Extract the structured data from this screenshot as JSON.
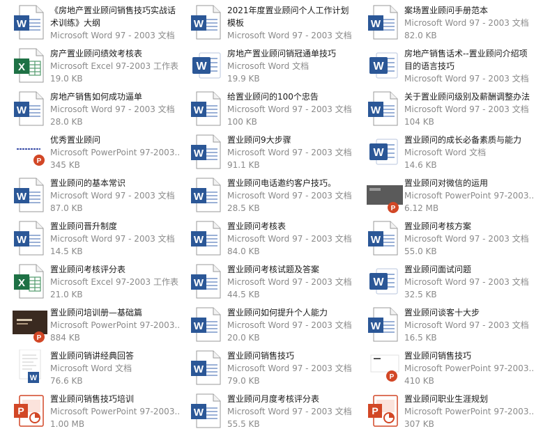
{
  "colors": {
    "word": "#2b5797",
    "excel": "#1e7145",
    "ppt": "#d24726",
    "name": "#1a1a1a",
    "meta": "#8a8a8a"
  },
  "files": [
    {
      "name": "《房地产置业顾问销售技巧实战话术训练》大纲",
      "type": "Microsoft Word 97 - 2003 文档",
      "size": "",
      "icon": "word-doc-icon",
      "kind": "word"
    },
    {
      "name": "2021年度置业顾问个人工作计划模板",
      "type": "Microsoft Word 97 - 2003 文档",
      "size": "",
      "icon": "word-doc-icon",
      "kind": "word"
    },
    {
      "name": "案场置业顾问手册范本",
      "type": "Microsoft Word 97 - 2003 文档",
      "size": "82.0 KB",
      "icon": "word-doc-icon",
      "kind": "word"
    },
    {
      "name": "房产置业顾问绩效考核表",
      "type": "Microsoft Excel 97-2003 工作表",
      "size": "19.0 KB",
      "icon": "excel-sheet-icon",
      "kind": "excel"
    },
    {
      "name": "房地产置业顾问销冠通单技巧",
      "type": "Microsoft Word 文档",
      "size": "19.9 KB",
      "icon": "word-app-icon",
      "kind": "wordapp"
    },
    {
      "name": "房地产销售话术--置业顾问介绍项目的语言技巧",
      "type": "Microsoft Word 97 - 2003 文档",
      "size": "",
      "icon": "word-app-icon",
      "kind": "wordapp"
    },
    {
      "name": "房地产销售如何成功逼单",
      "type": "Microsoft Word 97 - 2003 文档",
      "size": "28.0 KB",
      "icon": "word-doc-icon",
      "kind": "word"
    },
    {
      "name": "给置业顾问的100个忠告",
      "type": "Microsoft Word 97 - 2003 文档",
      "size": "100 KB",
      "icon": "word-doc-icon",
      "kind": "word"
    },
    {
      "name": "关于置业顾问级别及薪酬调整办法",
      "type": "Microsoft Word 97 - 2003 文档",
      "size": "104 KB",
      "icon": "word-doc-icon",
      "kind": "word"
    },
    {
      "name": "优秀置业顾问",
      "type": "Microsoft PowerPoint 97-2003...",
      "size": "345 KB",
      "icon": "slide-thumbnail-icon",
      "kind": "pptthumb"
    },
    {
      "name": "置业顾问9大步骤",
      "type": "Microsoft Word 97 - 2003 文档",
      "size": "91.1 KB",
      "icon": "word-doc-icon",
      "kind": "word"
    },
    {
      "name": "置业顾问的成长必备素质与能力",
      "type": "Microsoft Word 文档",
      "size": "14.6 KB",
      "icon": "word-app-icon",
      "kind": "wordapp"
    },
    {
      "name": "置业顾问的基本常识",
      "type": "Microsoft Word 97 - 2003 文档",
      "size": "87.0 KB",
      "icon": "word-doc-icon",
      "kind": "word"
    },
    {
      "name": "置业顾问电话邀约客户技巧。",
      "type": "Microsoft Word 97 - 2003 文档",
      "size": "28.5 KB",
      "icon": "word-doc-icon",
      "kind": "word"
    },
    {
      "name": "置业顾问对微信的运用",
      "type": "Microsoft PowerPoint 97-2003...",
      "size": "6.12 MB",
      "icon": "slide-thumbnail-icon",
      "kind": "pptgray"
    },
    {
      "name": "置业顾问晋升制度",
      "type": "Microsoft Word 97 - 2003 文档",
      "size": "14.5 KB",
      "icon": "word-doc-icon",
      "kind": "word"
    },
    {
      "name": "置业顾问考核表",
      "type": "Microsoft Word 97 - 2003 文档",
      "size": "84.0 KB",
      "icon": "word-doc-icon",
      "kind": "word"
    },
    {
      "name": "置业顾问考核方案",
      "type": "Microsoft Word 97 - 2003 文档",
      "size": "55.0 KB",
      "icon": "word-doc-icon",
      "kind": "word"
    },
    {
      "name": "置业顾问考核评分表",
      "type": "Microsoft Excel 97-2003 工作表",
      "size": "21.0 KB",
      "icon": "excel-sheet-icon",
      "kind": "excel"
    },
    {
      "name": "置业顾问考核试题及答案",
      "type": "Microsoft Word 97 - 2003 文档",
      "size": "44.5 KB",
      "icon": "word-doc-icon",
      "kind": "word"
    },
    {
      "name": "置业顾问面试问题",
      "type": "Microsoft Word 97 - 2003 文档",
      "size": "32.5 KB",
      "icon": "word-app-icon",
      "kind": "wordapp"
    },
    {
      "name": "置业顾问培训册—基础篇",
      "type": "Microsoft PowerPoint 97-2003...",
      "size": "884 KB",
      "icon": "slide-thumbnail-icon",
      "kind": "pptdark"
    },
    {
      "name": "置业顾问如何提升个人能力",
      "type": "Microsoft Word 97 - 2003 文档",
      "size": "20.0 KB",
      "icon": "word-doc-icon",
      "kind": "word"
    },
    {
      "name": "置业顾问谈客十大步",
      "type": "Microsoft Word 97 - 2003 文档",
      "size": "16.5 KB",
      "icon": "word-doc-icon",
      "kind": "word"
    },
    {
      "name": "置业顾问销讲经典回答",
      "type": "Microsoft Word 文档",
      "size": "76.6 KB",
      "icon": "document-thumbnail-icon",
      "kind": "wordthumb"
    },
    {
      "name": "置业顾问销售技巧",
      "type": "Microsoft Word 97 - 2003 文档",
      "size": "79.0 KB",
      "icon": "word-doc-icon",
      "kind": "word"
    },
    {
      "name": "置业顾问销售技巧",
      "type": "Microsoft PowerPoint 97-2003...",
      "size": "410 KB",
      "icon": "slide-thumbnail-icon",
      "kind": "pptwhite"
    },
    {
      "name": "置业顾问销售技巧培训",
      "type": "Microsoft PowerPoint 97-2003...",
      "size": "1.00 MB",
      "icon": "powerpoint-icon",
      "kind": "ppt"
    },
    {
      "name": "置业顾问月度考核评分表",
      "type": "Microsoft Word 97 - 2003 文档",
      "size": "55.5 KB",
      "icon": "word-doc-icon",
      "kind": "word"
    },
    {
      "name": "置业顾问职业生涯规划",
      "type": "Microsoft PowerPoint 97-2003...",
      "size": "307 KB",
      "icon": "powerpoint-icon",
      "kind": "ppt"
    }
  ]
}
